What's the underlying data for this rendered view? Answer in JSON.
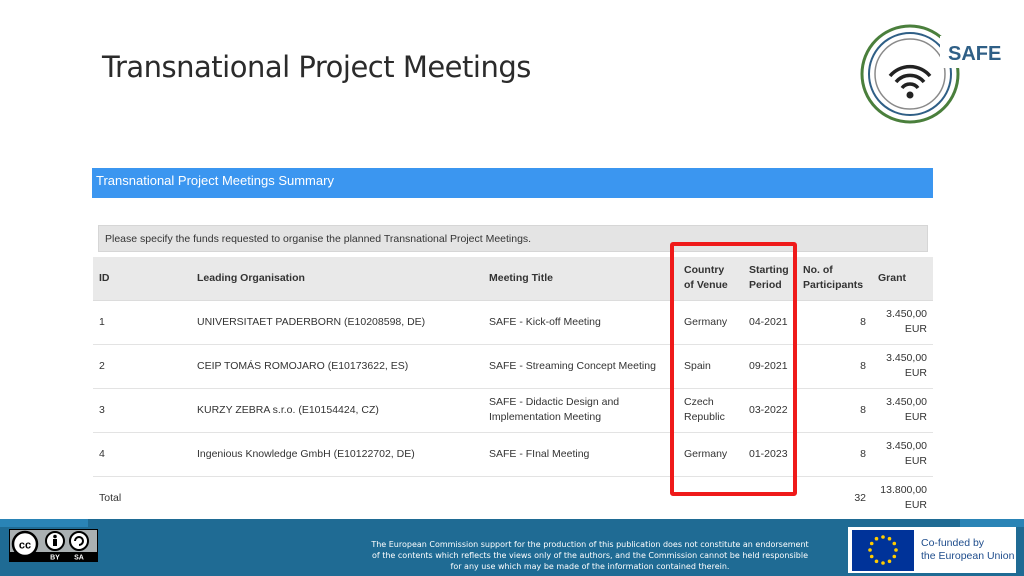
{
  "slide": {
    "title": "Transnational Project Meetings"
  },
  "logo": {
    "text": "SAFE"
  },
  "panel": {
    "header": "Transnational Project Meetings Summary",
    "instruction": "Please specify the funds requested to organise the planned Transnational Project Meetings."
  },
  "table": {
    "headers": {
      "id": "ID",
      "org": "Leading Organisation",
      "title": "Meeting Title",
      "country_l1": "Country",
      "country_l2": "of Venue",
      "period_l1": "Starting",
      "period_l2": "Period",
      "participants_l1": "No. of",
      "participants_l2": "Participants",
      "grant": "Grant"
    },
    "rows": [
      {
        "id": "1",
        "org": "UNIVERSITAET PADERBORN (E10208598, DE)",
        "title_l1": "SAFE - Kick-off Meeting",
        "title_l2": "",
        "country_l1": "Germany",
        "country_l2": "",
        "period": "04-2021",
        "participants": "8",
        "grant_l1": "3.450,00",
        "grant_l2": "EUR"
      },
      {
        "id": "2",
        "org": "CEIP TOMÁS ROMOJARO (E10173622, ES)",
        "title_l1": "SAFE - Streaming Concept Meeting",
        "title_l2": "",
        "country_l1": "Spain",
        "country_l2": "",
        "period": "09-2021",
        "participants": "8",
        "grant_l1": "3.450,00",
        "grant_l2": "EUR"
      },
      {
        "id": "3",
        "org": "KURZY ZEBRA s.r.o. (E10154424, CZ)",
        "title_l1": "SAFE - Didactic Design and",
        "title_l2": "Implementation Meeting",
        "country_l1": "Czech",
        "country_l2": "Republic",
        "period": "03-2022",
        "participants": "8",
        "grant_l1": "3.450,00",
        "grant_l2": "EUR"
      },
      {
        "id": "4",
        "org": "Ingenious Knowledge GmbH (E10122702, DE)",
        "title_l1": "SAFE - FInal Meeting",
        "title_l2": "",
        "country_l1": "Germany",
        "country_l2": "",
        "period": "01-2023",
        "participants": "8",
        "grant_l1": "3.450,00",
        "grant_l2": "EUR"
      }
    ],
    "total": {
      "label": "Total",
      "participants": "32",
      "grant_l1": "13.800,00",
      "grant_l2": "EUR"
    }
  },
  "footer": {
    "license_icon": "cc-by-sa-icon",
    "license_by": "BY",
    "license_sa": "SA",
    "disclaimer_l1": "The European Commission support for the production of this publication does not constitute an endorsement",
    "disclaimer_l2": "of the contents which reflects the views only of the authors, and the Commission cannot be held responsible",
    "disclaimer_l3": "for any use which may be made of the information contained therein.",
    "eu_l1": "Co-funded by",
    "eu_l2": "the European Union"
  },
  "colors": {
    "panel_header": "#3b96f0",
    "highlight": "#ef1a1a",
    "footer_bar": "#1f6b94",
    "logo_green": "#4a7f3c",
    "eu_blue": "#003399"
  }
}
